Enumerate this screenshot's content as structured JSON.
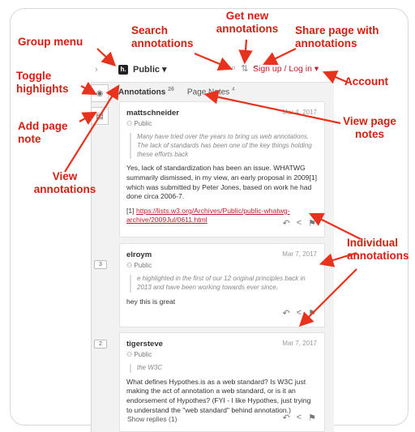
{
  "callouts": {
    "group_menu": "Group menu",
    "search": "Search annotations",
    "get_new": "Get new annotations",
    "share": "Share page with annotations",
    "toggle": "Toggle highlights",
    "add_note": "Add page note",
    "account": "Account",
    "view_annotations": "View annotations",
    "view_notes": "View page notes",
    "individual": "Individual annotations"
  },
  "topbar": {
    "chevron": "›",
    "logo": "h.",
    "group_label": "Public ▾",
    "search_icon": "⌕",
    "refresh_icon": "⇅",
    "share_icon": "<",
    "signup": "Sign up / Log in ▾"
  },
  "tools": {
    "eye_icon": "◉",
    "note_icon": "▤"
  },
  "tabs": {
    "annotations": "Annotations",
    "annotations_count": "26",
    "notes": "Page Notes",
    "notes_count": "4"
  },
  "cards": [
    {
      "author": "mattschneider",
      "date": "Mar 4, 2017",
      "scope": "Public",
      "quote": "Many have tried over the years to bring us web annotations. The lack of standards has been one of the key things holding these efforts back",
      "body": "Yes, lack of standardization has been an issue. WHATWG summarily dismissed, in my view, an early proposal in 2009[1] which was submitted by Peter Jones, based on work he had done circa 2006-7.",
      "link_prefix": "[1] ",
      "link": "https://lists.w3.org/Archives/Public/public-whatwg-archive/2009Jul/0611.html"
    },
    {
      "author": "elroym",
      "date": "Mar 7, 2017",
      "scope": "Public",
      "badge": "3",
      "quote": "e highlighted in the first of our 12 original principles back in 2013 and have been working towards ever since.",
      "body": "hey this is great"
    },
    {
      "author": "tigersteve",
      "date": "Mar 7, 2017",
      "scope": "Public",
      "badge": "2",
      "quote": "the W3C",
      "body": "What defines Hypothes.is as a web standard? Is W3C just making the act of annotation a web standard, or is it an endorsement of Hypothes? (FYI - I like Hypothes, just trying to understand the \"web standard\" behind annotation.)",
      "replies": "Show replies (1)"
    }
  ],
  "actions": {
    "reply_icon": "↶",
    "share_icon": "<",
    "flag_icon": "⚑"
  }
}
